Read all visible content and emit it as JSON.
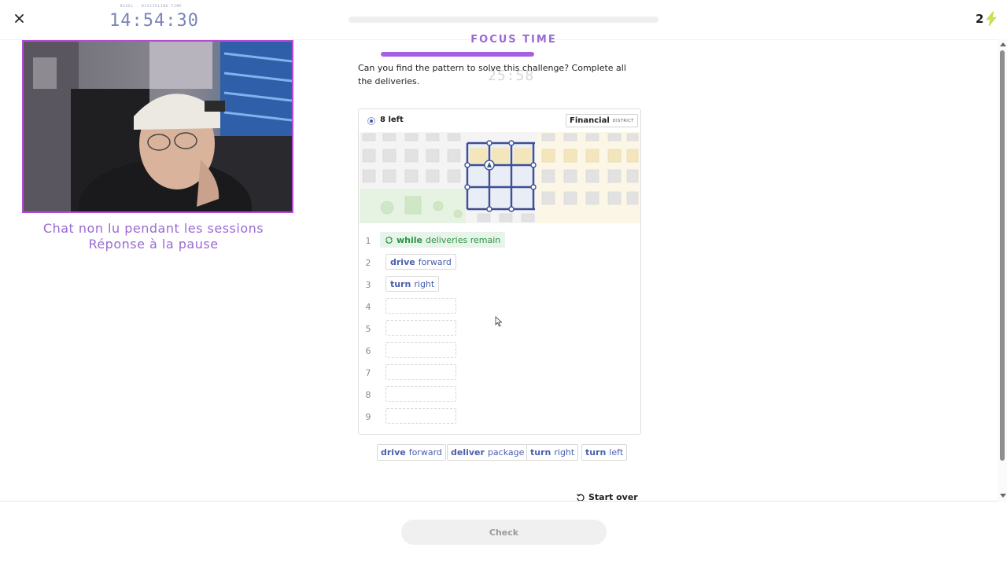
{
  "header": {
    "close_icon": "close-icon",
    "timer_caption": "REGEL · DISCIPLINE TIME",
    "timer": "14:54:30",
    "streak_count": "2",
    "streak_icon": "bolt-icon",
    "accent": "#a761e0"
  },
  "webcam": {
    "chat_line1": "Chat non lu pendant les sessions",
    "chat_line2": "Réponse à la pause"
  },
  "focus": {
    "label": "FOCUS TIME",
    "ghost_time": "25:58"
  },
  "challenge": {
    "prompt": "Can you find the pattern to solve this challenge? Complete all the deliveries."
  },
  "panel": {
    "left_count": "8 left",
    "district_name": "Financial",
    "district_sub": "DISTRICT"
  },
  "code": {
    "lines": [
      {
        "num": "1",
        "kw": "while",
        "arg": "deliveries remain"
      },
      {
        "num": "2",
        "kw": "drive",
        "arg": "forward"
      },
      {
        "num": "3",
        "kw": "turn",
        "arg": "right"
      },
      {
        "num": "4"
      },
      {
        "num": "5"
      },
      {
        "num": "6"
      },
      {
        "num": "7"
      },
      {
        "num": "8"
      },
      {
        "num": "9"
      }
    ]
  },
  "palette": [
    {
      "kw": "drive",
      "arg": "forward"
    },
    {
      "kw": "deliver",
      "arg": "package"
    },
    {
      "kw": "turn",
      "arg": "right"
    },
    {
      "kw": "turn",
      "arg": "left"
    }
  ],
  "actions": {
    "start_over": "Start over",
    "check": "Check"
  }
}
